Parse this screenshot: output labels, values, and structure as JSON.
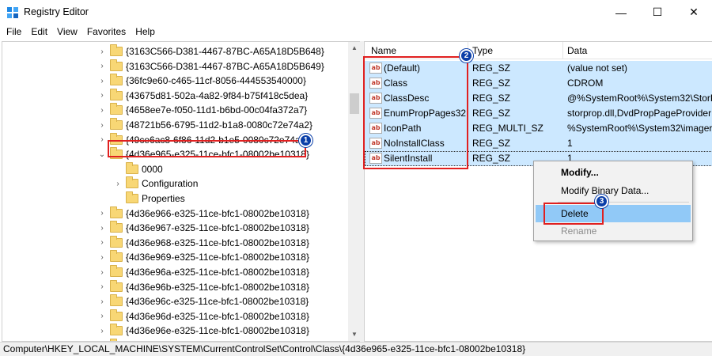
{
  "window": {
    "title": "Registry Editor",
    "min_glyph": "—",
    "max_glyph": "☐",
    "close_glyph": "✕"
  },
  "menu": [
    "File",
    "Edit",
    "View",
    "Favorites",
    "Help"
  ],
  "tree": {
    "rows": [
      {
        "label": "{3163C566-D381-4467-87BC-A65A18D5B648}",
        "chevron": "›"
      },
      {
        "label": "{3163C566-D381-4467-87BC-A65A18D5B649}",
        "chevron": "›"
      },
      {
        "label": "{36fc9e60-c465-11cf-8056-444553540000}",
        "chevron": "›"
      },
      {
        "label": "{43675d81-502a-4a82-9f84-b75f418c5dea}",
        "chevron": "›"
      },
      {
        "label": "{4658ee7e-f050-11d1-b6bd-00c04fa372a7}",
        "chevron": "›"
      },
      {
        "label": "{48721b56-6795-11d2-b1a8-0080c72e74a2}",
        "chevron": "›"
      },
      {
        "label": "{49ce6ac8-6f86-11d2-b1e5-0080c72e74a2}",
        "chevron": "›"
      },
      {
        "label": "{4d36e965-e325-11ce-bfc1-08002be10318}",
        "chevron": "⌄"
      },
      {
        "label": "0000",
        "chevron": ""
      },
      {
        "label": "Configuration",
        "chevron": "›"
      },
      {
        "label": "Properties",
        "chevron": ""
      },
      {
        "label": "{4d36e966-e325-11ce-bfc1-08002be10318}",
        "chevron": "›"
      },
      {
        "label": "{4d36e967-e325-11ce-bfc1-08002be10318}",
        "chevron": "›"
      },
      {
        "label": "{4d36e968-e325-11ce-bfc1-08002be10318}",
        "chevron": "›"
      },
      {
        "label": "{4d36e969-e325-11ce-bfc1-08002be10318}",
        "chevron": "›"
      },
      {
        "label": "{4d36e96a-e325-11ce-bfc1-08002be10318}",
        "chevron": "›"
      },
      {
        "label": "{4d36e96b-e325-11ce-bfc1-08002be10318}",
        "chevron": "›"
      },
      {
        "label": "{4d36e96c-e325-11ce-bfc1-08002be10318}",
        "chevron": "›"
      },
      {
        "label": "{4d36e96d-e325-11ce-bfc1-08002be10318}",
        "chevron": "›"
      },
      {
        "label": "{4d36e96e-e325-11ce-bfc1-08002be10318}",
        "chevron": "›"
      },
      {
        "label": "{4d36e96f-e325-11ce-bfc1-08002be10318}",
        "chevron": "›"
      }
    ]
  },
  "list": {
    "headers": [
      "Name",
      "Type",
      "Data"
    ],
    "rows": [
      {
        "name": "(Default)",
        "type": "REG_SZ",
        "data": "(value not set)"
      },
      {
        "name": "Class",
        "type": "REG_SZ",
        "data": "CDROM"
      },
      {
        "name": "ClassDesc",
        "type": "REG_SZ",
        "data": "@%SystemRoot%\\System32\\StorP"
      },
      {
        "name": "EnumPropPages32",
        "type": "REG_SZ",
        "data": "storprop.dll,DvdPropPageProvider"
      },
      {
        "name": "IconPath",
        "type": "REG_MULTI_SZ",
        "data": "%SystemRoot%\\System32\\imagere"
      },
      {
        "name": "NoInstallClass",
        "type": "REG_SZ",
        "data": "1"
      },
      {
        "name": "SilentInstall",
        "type": "REG_SZ",
        "data": "1"
      }
    ],
    "value_icon_text": "ab"
  },
  "context_menu": {
    "items": [
      "Modify...",
      "Modify Binary Data...",
      "Delete",
      "Rename"
    ]
  },
  "annotations": [
    "1",
    "2",
    "3"
  ],
  "colors": {
    "selection": "#cce8ff",
    "highlight": "#91c9f7",
    "annotation_box": "#e02020",
    "badge": "#0a3ea8"
  },
  "status": "Computer\\HKEY_LOCAL_MACHINE\\SYSTEM\\CurrentControlSet\\Control\\Class\\{4d36e965-e325-11ce-bfc1-08002be10318}"
}
